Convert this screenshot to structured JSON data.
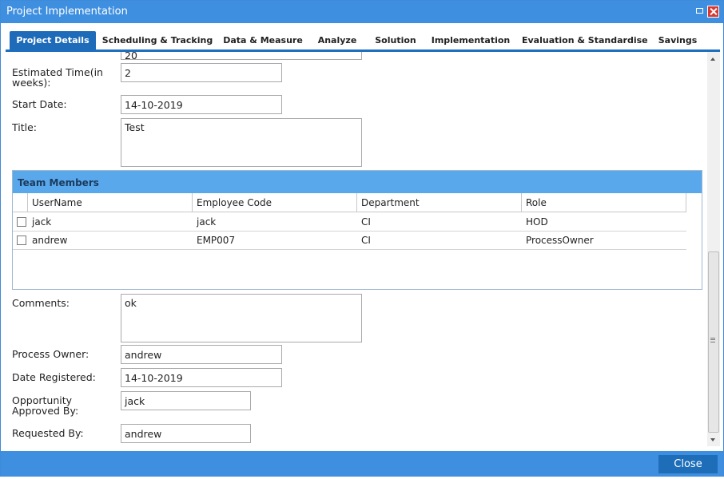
{
  "window": {
    "title": "Project Implementation"
  },
  "tabs": [
    {
      "label": "Project Details",
      "active": true
    },
    {
      "label": "Scheduling & Tracking",
      "active": false
    },
    {
      "label": "Data & Measure",
      "active": false
    },
    {
      "label": "Analyze",
      "active": false
    },
    {
      "label": "Solution",
      "active": false
    },
    {
      "label": "Implementation",
      "active": false
    },
    {
      "label": "Evaluation & Standardise",
      "active": false
    },
    {
      "label": "Savings",
      "active": false
    }
  ],
  "form": {
    "top_field_partial": "20",
    "estimated_time_label": "Estimated Time(in weeks):",
    "estimated_time_value": "2",
    "start_date_label": "Start Date:",
    "start_date_value": "14-10-2019",
    "title_label": "Title:",
    "title_value": "Test",
    "comments_label": "Comments:",
    "comments_value": "ok",
    "process_owner_label": "Process Owner:",
    "process_owner_value": "andrew",
    "date_registered_label": "Date Registered:",
    "date_registered_value": "14-10-2019",
    "approved_by_label": "Opportunity Approved By:",
    "approved_by_value": "jack",
    "requested_by_label": "Requested By:",
    "requested_by_value": "andrew"
  },
  "team": {
    "title": "Team Members",
    "columns": [
      "UserName",
      "Employee Code",
      "Department",
      "Role"
    ],
    "rows": [
      {
        "username": "jack",
        "employee_code": "jack",
        "department": "CI",
        "role": "HOD"
      },
      {
        "username": "andrew",
        "employee_code": "EMP007",
        "department": "CI",
        "role": "ProcessOwner"
      }
    ]
  },
  "footer": {
    "close_label": "Close"
  },
  "colors": {
    "title_bar": "#3f8fe0",
    "active_tab": "#1e6cb9",
    "grid_header": "#5aa8ec",
    "close_button": "#1d6db8"
  },
  "icons": [
    "restore-icon",
    "close-icon",
    "scroll-up-icon",
    "scroll-down-icon"
  ]
}
